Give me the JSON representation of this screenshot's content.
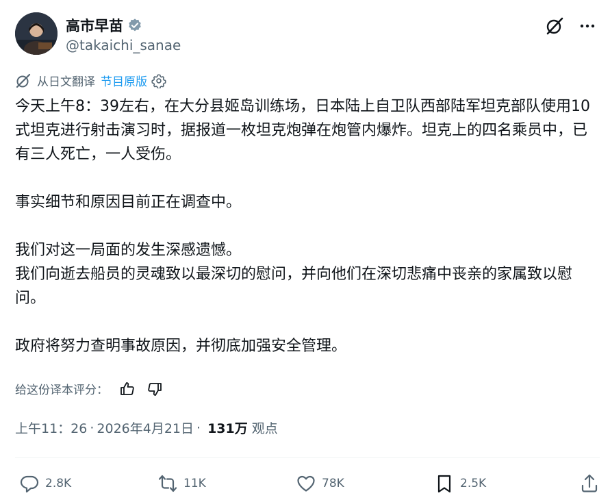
{
  "author": {
    "display_name": "高市早苗",
    "handle": "@takaichi_sanae"
  },
  "translation": {
    "label": "从日文翻译",
    "show_original": "节目原版"
  },
  "tweet": {
    "paragraphs": [
      "今天上午8：39左右，在大分县姬岛训练场，日本陆上自卫队西部陆军坦克部队使用10式坦克进行射击演习时，据报道一枚坦克炮弹在炮管内爆炸。坦克上的四名乘员中，已有三人死亡，一人受伤。",
      "事实细节和原因目前正在调查中。",
      "我们对这一局面的发生深感遗憾。",
      "我们向逝去船员的灵魂致以最深切的慰问，并向他们在深切悲痛中丧亲的家属致以慰问。",
      "政府将努力查明事故原因，并彻底加强安全管理。"
    ]
  },
  "rating": {
    "label": "给这份译本评分："
  },
  "meta": {
    "time": "上午11：26",
    "date": "2026年4月21日",
    "views_count": "131万",
    "views_label": "观点"
  },
  "actions": {
    "replies": "2.8K",
    "reposts": "11K",
    "likes": "78K",
    "bookmarks": "2.5K"
  },
  "icons": [
    "verified-badge-icon",
    "grok-icon",
    "more-icon",
    "translate-icon",
    "gear-icon",
    "thumbs-up-icon",
    "thumbs-down-icon",
    "reply-icon",
    "repost-icon",
    "like-icon",
    "bookmark-icon",
    "share-icon"
  ],
  "colors": {
    "text": "#0f1419",
    "secondary": "#536471",
    "accent": "#1d9bf0"
  }
}
